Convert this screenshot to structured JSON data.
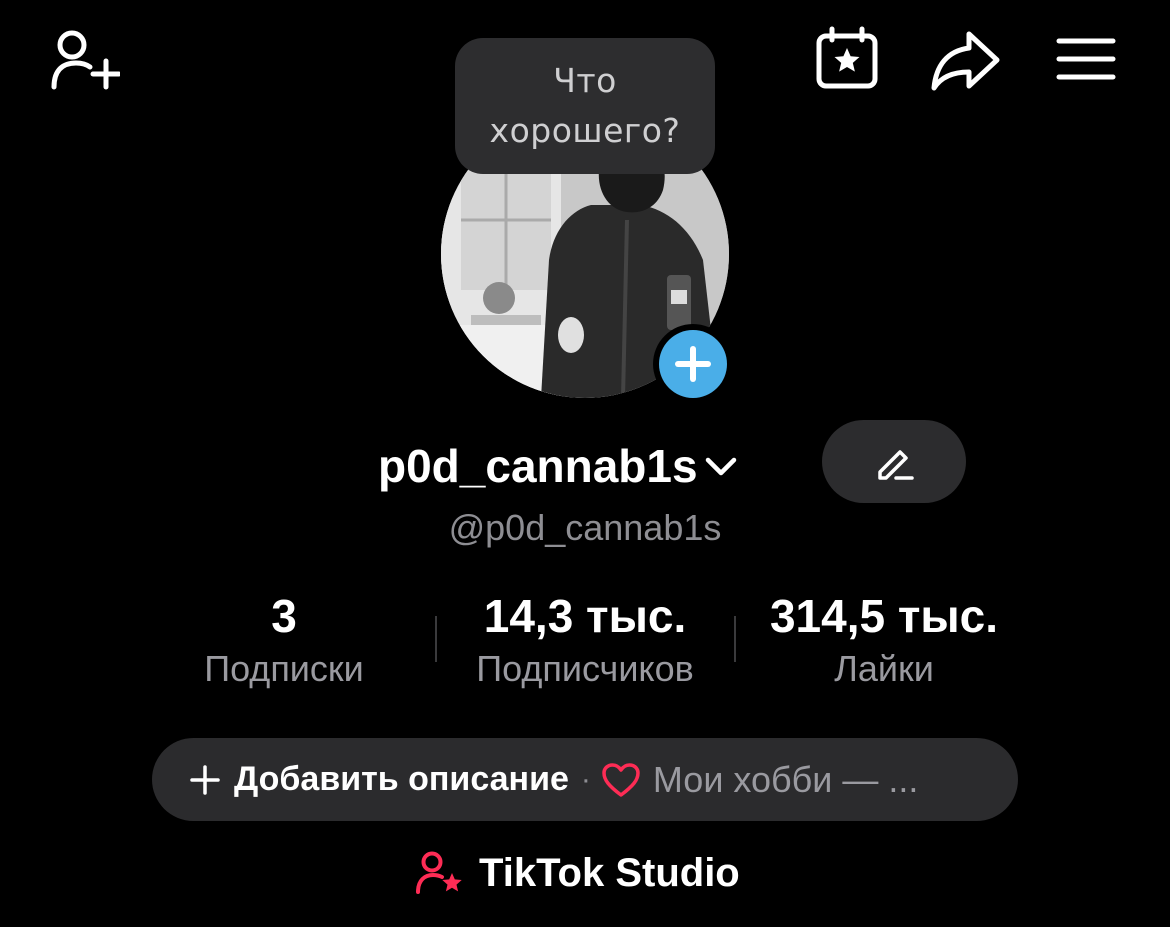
{
  "header": {
    "add_friend_icon": "person-plus-icon",
    "calendar_icon": "calendar-star-icon",
    "share_icon": "share-arrow-icon",
    "menu_icon": "hamburger-menu-icon"
  },
  "prompt_bubble": {
    "line1": "Что",
    "line2": "хорошего?"
  },
  "profile": {
    "display_name": "p0d_cannab1s",
    "handle": "@p0d_cannab1s",
    "edit_icon": "pencil-icon",
    "add_avatar_icon": "plus-icon"
  },
  "stats": [
    {
      "value": "3",
      "label": "Подписки"
    },
    {
      "value": "14,3 тыс.",
      "label": "Подписчиков"
    },
    {
      "value": "314,5 тыс.",
      "label": "Лайки"
    }
  ],
  "bio": {
    "add_label": "Добавить описание",
    "separator": "·",
    "hobby_text": "Мои хобби — ..."
  },
  "studio": {
    "label": "TikTok Studio"
  },
  "colors": {
    "background": "#000000",
    "accent_blue": "#4aaee8",
    "accent_red": "#fe2c55",
    "pill": "#2b2b2d"
  }
}
